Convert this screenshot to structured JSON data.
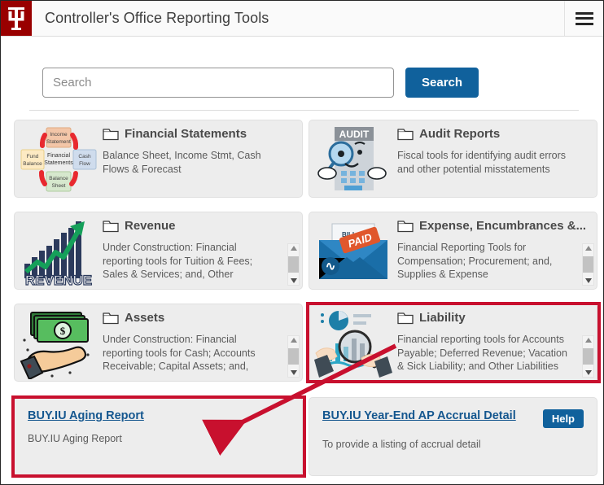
{
  "header": {
    "logo_alt": "IU trident logo",
    "title": "Controller's Office Reporting Tools",
    "menu_icon": "hamburger-menu-icon"
  },
  "search": {
    "placeholder": "Search",
    "value": "",
    "button_label": "Search"
  },
  "categories": [
    {
      "id": "financial-statements",
      "title": "Financial Statements",
      "description": "Balance Sheet, Income Stmt, Cash Flows & Forecast",
      "thumb": "financial-statements-cycle-thumbnail",
      "scrollable": false,
      "highlighted": false
    },
    {
      "id": "audit-reports",
      "title": "Audit Reports",
      "description": "Fiscal tools for identifying audit errors and other potential misstatements",
      "thumb": "audit-magnifier-thumbnail",
      "scrollable": false,
      "highlighted": false
    },
    {
      "id": "revenue",
      "title": "Revenue",
      "description": "Under Construction: Financial reporting tools for Tuition & Fees; Sales & Services; and, Other Revenue",
      "thumb": "revenue-growth-chart-thumbnail",
      "scrollable": true,
      "highlighted": false
    },
    {
      "id": "expense-encumbrances",
      "title": "Expense, Encumbrances &...",
      "description": "Financial Reporting Tools for Compensation; Procurement; and, Supplies & Expense",
      "thumb": "paid-bill-envelope-thumbnail",
      "scrollable": true,
      "highlighted": false
    },
    {
      "id": "assets",
      "title": "Assets",
      "description": "Under Construction: Financial reporting tools for Cash; Accounts Receivable; Capital Assets; and, Other",
      "thumb": "cash-in-hand-thumbnail",
      "scrollable": true,
      "highlighted": false
    },
    {
      "id": "liability",
      "title": "Liability",
      "description": "Financial reporting tools for Accounts Payable; Deferred Revenue; Vacation & Sick Liability; and Other Liabilities",
      "thumb": "data-analysis-magnifier-thumbnail",
      "scrollable": true,
      "highlighted": true
    }
  ],
  "reports": [
    {
      "id": "buyiu-aging-report",
      "link_label": "BUY.IU Aging Report",
      "description": "BUY.IU Aging Report",
      "has_help": false,
      "help_label": "",
      "highlighted": true
    },
    {
      "id": "buyiu-year-end-ap-accrual-detail",
      "link_label": "BUY.IU Year-End AP Accrual Detail",
      "description": "To provide a listing of accrual detail",
      "has_help": true,
      "help_label": "Help",
      "highlighted": false
    }
  ],
  "annotation": {
    "arrow_color": "#c8102e",
    "box_color": "#c8102e",
    "arrow_from": "liability-card",
    "arrow_to": "buyiu-aging-report-card"
  },
  "colors": {
    "iu_crimson": "#990000",
    "link_blue": "#15578f",
    "button_blue": "#10619c",
    "annotation_red": "#c8102e",
    "card_bg": "#ededed"
  }
}
